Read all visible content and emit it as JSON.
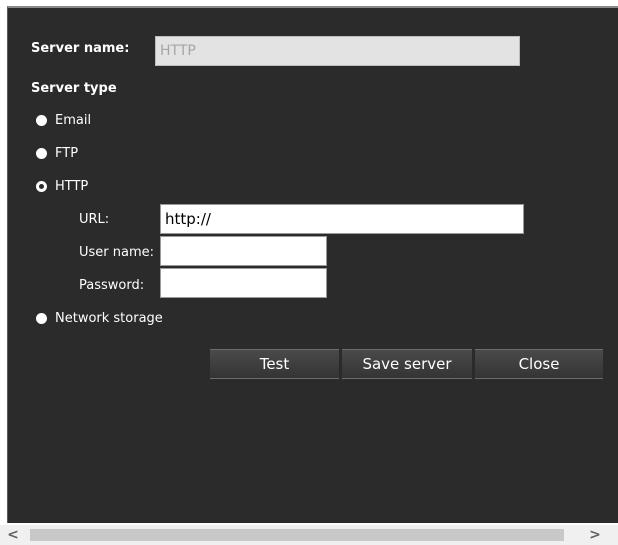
{
  "form": {
    "server_name_label": "Server name:",
    "server_name_value": "HTTP",
    "server_type_label": "Server type",
    "options": [
      {
        "label": "Email",
        "checked": false
      },
      {
        "label": "FTP",
        "checked": false
      },
      {
        "label": "HTTP",
        "checked": true
      },
      {
        "label": "Network storage",
        "checked": false
      }
    ],
    "http": {
      "url_label": "URL:",
      "url_value": "http://",
      "user_label": "User name:",
      "user_value": "",
      "password_label": "Password:",
      "password_value": ""
    }
  },
  "buttons": {
    "test": "Test",
    "save": "Save server",
    "close": "Close"
  },
  "scrollbar": {
    "left_icon": "chevron-left-icon",
    "right_icon": "chevron-right-icon"
  },
  "colors": {
    "panel_bg": "#2b2b2b",
    "text": "#ffffff"
  }
}
